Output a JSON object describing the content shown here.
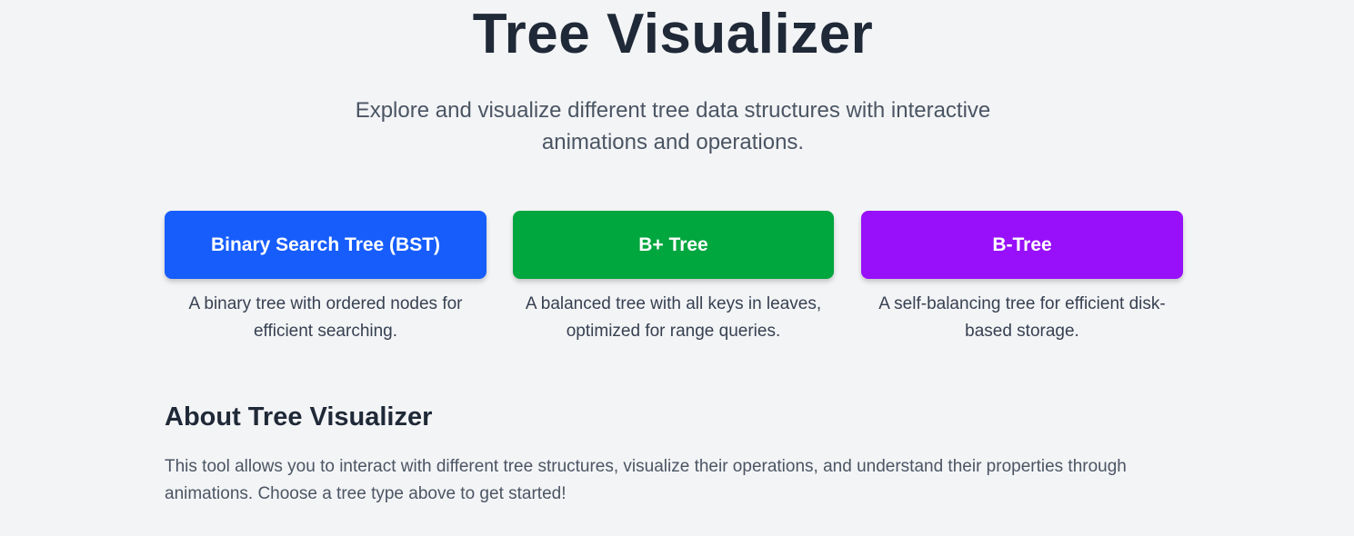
{
  "header": {
    "title": "Tree Visualizer",
    "subtitle": "Explore and visualize different tree data structures with interactive animations and operations."
  },
  "trees": [
    {
      "label": "Binary Search Tree (BST)",
      "description": "A binary tree with ordered nodes for efficient searching.",
      "color": "#165dfc"
    },
    {
      "label": "B+ Tree",
      "description": "A balanced tree with all keys in leaves, optimized for range queries.",
      "color": "#00a63e"
    },
    {
      "label": "B-Tree",
      "description": "A self-balancing tree for efficient disk-based storage.",
      "color": "#9810fa"
    }
  ],
  "about": {
    "heading": "About Tree Visualizer",
    "text": "This tool allows you to interact with different tree structures, visualize their operations, and understand their properties through animations. Choose a tree type above to get started!"
  },
  "colors": {
    "background": "#f3f4f6",
    "heading": "#1f2937",
    "body_text": "#4b5563"
  }
}
